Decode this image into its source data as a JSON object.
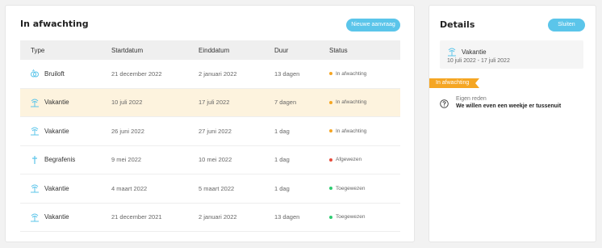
{
  "main": {
    "title": "In afwachting",
    "new_request_label": "Nieuwe aanvraag",
    "columns": [
      "Type",
      "Startdatum",
      "Einddatum",
      "Duur",
      "Status"
    ],
    "rows": [
      {
        "type": "Bruiloft",
        "icon": "rings-icon",
        "start": "21 december 2022",
        "end": "2 januari 2022",
        "duration": "13 dagen",
        "status": "In afwachting",
        "status_color": "#f5a623"
      },
      {
        "type": "Vakantie",
        "icon": "palm-tree-icon",
        "start": "10 juli 2022",
        "end": "17 juli 2022",
        "duration": "7 dagen",
        "status": "In afwachting",
        "status_color": "#f5a623"
      },
      {
        "type": "Vakantie",
        "icon": "palm-tree-icon",
        "start": "26 juni 2022",
        "end": "27 juni 2022",
        "duration": "1 dag",
        "status": "In afwachting",
        "status_color": "#f5a623"
      },
      {
        "type": "Begrafenis",
        "icon": "cross-icon",
        "start": "9 mei 2022",
        "end": "10 mei 2022",
        "duration": "1 dag",
        "status": "Afgewezen",
        "status_color": "#e74c3c"
      },
      {
        "type": "Vakantie",
        "icon": "palm-tree-icon",
        "start": "4 maart 2022",
        "end": "5 maart 2022",
        "duration": "1 dag",
        "status": "Toegewezen",
        "status_color": "#2ecc71"
      },
      {
        "type": "Vakantie",
        "icon": "palm-tree-icon",
        "start": "21 december 2021",
        "end": "2 januari 2022",
        "duration": "13 dagen",
        "status": "Toegewezen",
        "status_color": "#2ecc71"
      }
    ]
  },
  "details": {
    "title": "Details",
    "close_label": "Sluiten",
    "type": "Vakantie",
    "icon": "palm-tree-icon",
    "dates": "10 juli 2022 - 17 juli 2022",
    "status_ribbon": "In afwachting",
    "reason_label": "Eigen reden",
    "reason_text": "We willen even een weekje er tussenuit"
  },
  "colors": {
    "accent": "#5bc5ea",
    "pending": "#f5a623",
    "selected_row": "#fdf3de"
  }
}
